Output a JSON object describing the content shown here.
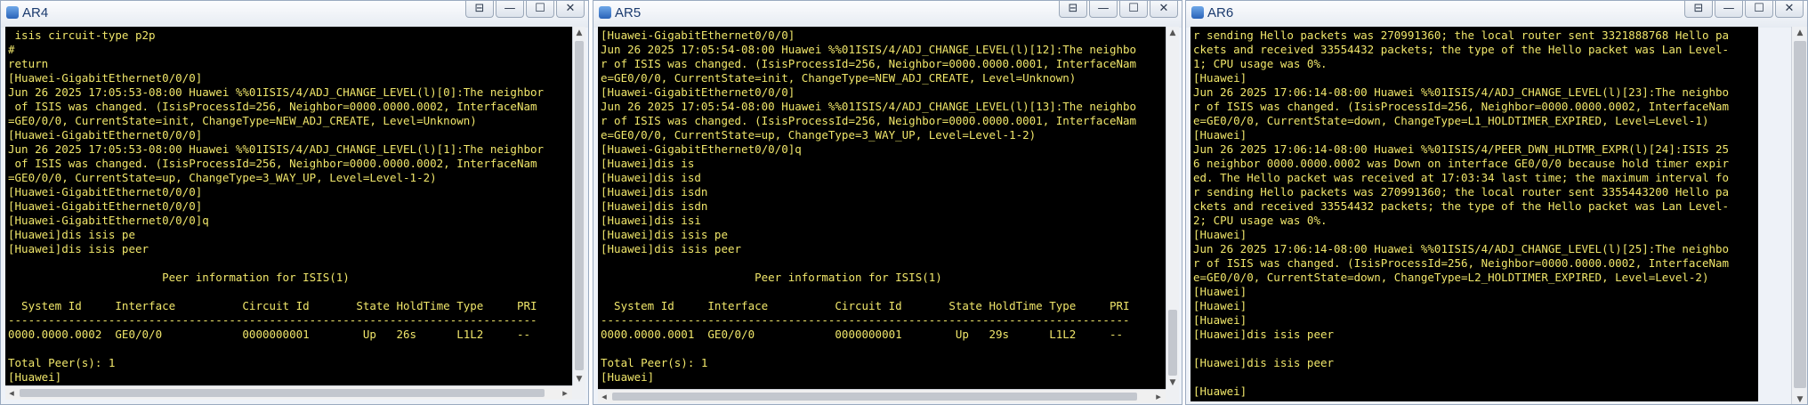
{
  "windows": [
    {
      "title": "AR4",
      "controls": [
        "⊟",
        "—",
        "☐",
        "✕"
      ],
      "lines": [
        " isis circuit-type p2p",
        "#",
        "return",
        "[Huawei-GigabitEthernet0/0/0]",
        "Jun 26 2025 17:05:53-08:00 Huawei %%01ISIS/4/ADJ_CHANGE_LEVEL(l)[0]:The neighbor",
        " of ISIS was changed. (IsisProcessId=256, Neighbor=0000.0000.0002, InterfaceNam",
        "=GE0/0/0, CurrentState=init, ChangeType=NEW_ADJ_CREATE, Level=Unknown)",
        "[Huawei-GigabitEthernet0/0/0]",
        "Jun 26 2025 17:05:53-08:00 Huawei %%01ISIS/4/ADJ_CHANGE_LEVEL(l)[1]:The neighbor",
        " of ISIS was changed. (IsisProcessId=256, Neighbor=0000.0000.0002, InterfaceNam",
        "=GE0/0/0, CurrentState=up, ChangeType=3_WAY_UP, Level=Level-1-2)",
        "[Huawei-GigabitEthernet0/0/0]",
        "[Huawei-GigabitEthernet0/0/0]",
        "[Huawei-GigabitEthernet0/0/0]q",
        "[Huawei]dis isis pe",
        "[Huawei]dis isis peer",
        "",
        "                       Peer information for ISIS(1)",
        "",
        "  System Id     Interface          Circuit Id       State HoldTime Type     PRI",
        "-------------------------------------------------------------------------------",
        "0000.0000.0002  GE0/0/0            0000000001        Up   26s      L1L2     --",
        "",
        "Total Peer(s): 1",
        "[Huawei]"
      ]
    },
    {
      "title": "AR5",
      "controls": [
        "⊟",
        "—",
        "☐",
        "✕"
      ],
      "lines": [
        "[Huawei-GigabitEthernet0/0/0]",
        "Jun 26 2025 17:05:54-08:00 Huawei %%01ISIS/4/ADJ_CHANGE_LEVEL(l)[12]:The neighbo",
        "r of ISIS was changed. (IsisProcessId=256, Neighbor=0000.0000.0001, InterfaceNam",
        "e=GE0/0/0, CurrentState=init, ChangeType=NEW_ADJ_CREATE, Level=Unknown)",
        "[Huawei-GigabitEthernet0/0/0]",
        "Jun 26 2025 17:05:54-08:00 Huawei %%01ISIS/4/ADJ_CHANGE_LEVEL(l)[13]:The neighbo",
        "r of ISIS was changed. (IsisProcessId=256, Neighbor=0000.0000.0001, InterfaceNam",
        "e=GE0/0/0, CurrentState=up, ChangeType=3_WAY_UP, Level=Level-1-2)",
        "[Huawei-GigabitEthernet0/0/0]q",
        "[Huawei]dis is",
        "[Huawei]dis isd",
        "[Huawei]dis isdn",
        "[Huawei]dis isdn",
        "[Huawei]dis isi",
        "[Huawei]dis isis pe",
        "[Huawei]dis isis peer",
        "",
        "                       Peer information for ISIS(1)",
        "",
        "  System Id     Interface          Circuit Id       State HoldTime Type     PRI",
        "-------------------------------------------------------------------------------",
        "0000.0000.0001  GE0/0/0            0000000001        Up   29s      L1L2     --",
        "",
        "Total Peer(s): 1",
        "[Huawei]"
      ]
    },
    {
      "title": "AR6",
      "controls": [
        "⊟",
        "—",
        "☐",
        "✕"
      ],
      "lines": [
        "r sending Hello packets was 270991360; the local router sent 3321888768 Hello pa",
        "ckets and received 33554432 packets; the type of the Hello packet was Lan Level-",
        "1; CPU usage was 0%.",
        "[Huawei]",
        "Jun 26 2025 17:06:14-08:00 Huawei %%01ISIS/4/ADJ_CHANGE_LEVEL(l)[23]:The neighbo",
        "r of ISIS was changed. (IsisProcessId=256, Neighbor=0000.0000.0002, InterfaceNam",
        "e=GE0/0/0, CurrentState=down, ChangeType=L1_HOLDTIMER_EXPIRED, Level=Level-1)",
        "[Huawei]",
        "Jun 26 2025 17:06:14-08:00 Huawei %%01ISIS/4/PEER_DWN_HLDTMR_EXPR(l)[24]:ISIS 25",
        "6 neighbor 0000.0000.0002 was Down on interface GE0/0/0 because hold timer expir",
        "ed. The Hello packet was received at 17:03:34 last time; the maximum interval fo",
        "r sending Hello packets was 270991360; the local router sent 3355443200 Hello pa",
        "ckets and received 33554432 packets; the type of the Hello packet was Lan Level-",
        "2; CPU usage was 0%.",
        "[Huawei]",
        "Jun 26 2025 17:06:14-08:00 Huawei %%01ISIS/4/ADJ_CHANGE_LEVEL(l)[25]:The neighbo",
        "r of ISIS was changed. (IsisProcessId=256, Neighbor=0000.0000.0002, InterfaceNam",
        "e=GE0/0/0, CurrentState=down, ChangeType=L2_HOLDTIMER_EXPIRED, Level=Level-2)",
        "[Huawei]",
        "[Huawei]",
        "[Huawei]",
        "[Huawei]dis isis peer",
        "",
        "[Huawei]dis isis peer",
        "",
        "[Huawei]"
      ]
    }
  ]
}
